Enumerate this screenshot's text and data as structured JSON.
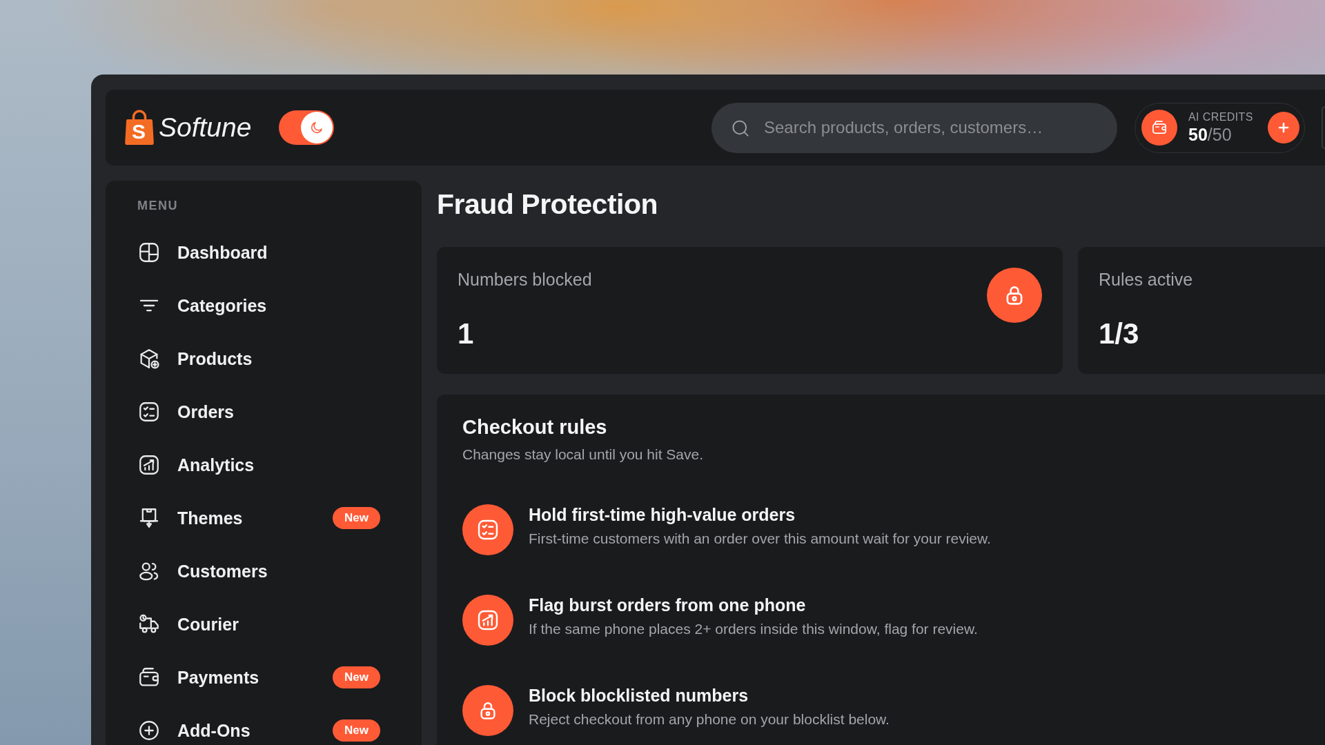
{
  "header": {
    "logo": {
      "mark": "S",
      "name": "Softune"
    },
    "theme_toggle": {
      "on": true
    },
    "search": {
      "placeholder": "Search products, orders, customers…"
    },
    "credits": {
      "label": "AI CREDITS",
      "count": "**50**/50"
    }
  },
  "sidebar": {
    "heading": "MENU",
    "items": [
      {
        "label": "Dashboard",
        "selected": false
      },
      {
        "label": "Categories",
        "selected": false
      },
      {
        "label": "Products",
        "selected": false
      },
      {
        "label": "Orders",
        "selected": false
      },
      {
        "label": "Analytics",
        "selected": false
      },
      {
        "label": "Themes",
        "badge": "New",
        "selected": false
      },
      {
        "label": "Customers",
        "selected": false
      },
      {
        "label": "Courier",
        "selected": false
      },
      {
        "label": "Payments",
        "badge": "New",
        "selected": false
      },
      {
        "label": "Add-Ons",
        "badge": "New",
        "selected": false
      }
    ]
  },
  "page": {
    "title": "Fraud Protection"
  },
  "stats": [
    {
      "label": "Numbers blocked",
      "value": "1"
    },
    {
      "label": "Rules active",
      "value": "1/3"
    }
  ],
  "checkout_rules": {
    "title": "Checkout rules",
    "subtitle": "Changes stay local until you hit Save.",
    "rules": [
      {
        "title": "Hold first-time high-value orders",
        "description": "First-time customers with an order over this amount wait for your review."
      },
      {
        "title": "Flag burst orders from one phone",
        "description": "If the same phone places 2+ orders inside this window, flag for review."
      },
      {
        "title": "Block blocklisted numbers",
        "description": "Reject checkout from any phone on your blocklist below."
      }
    ]
  }
}
